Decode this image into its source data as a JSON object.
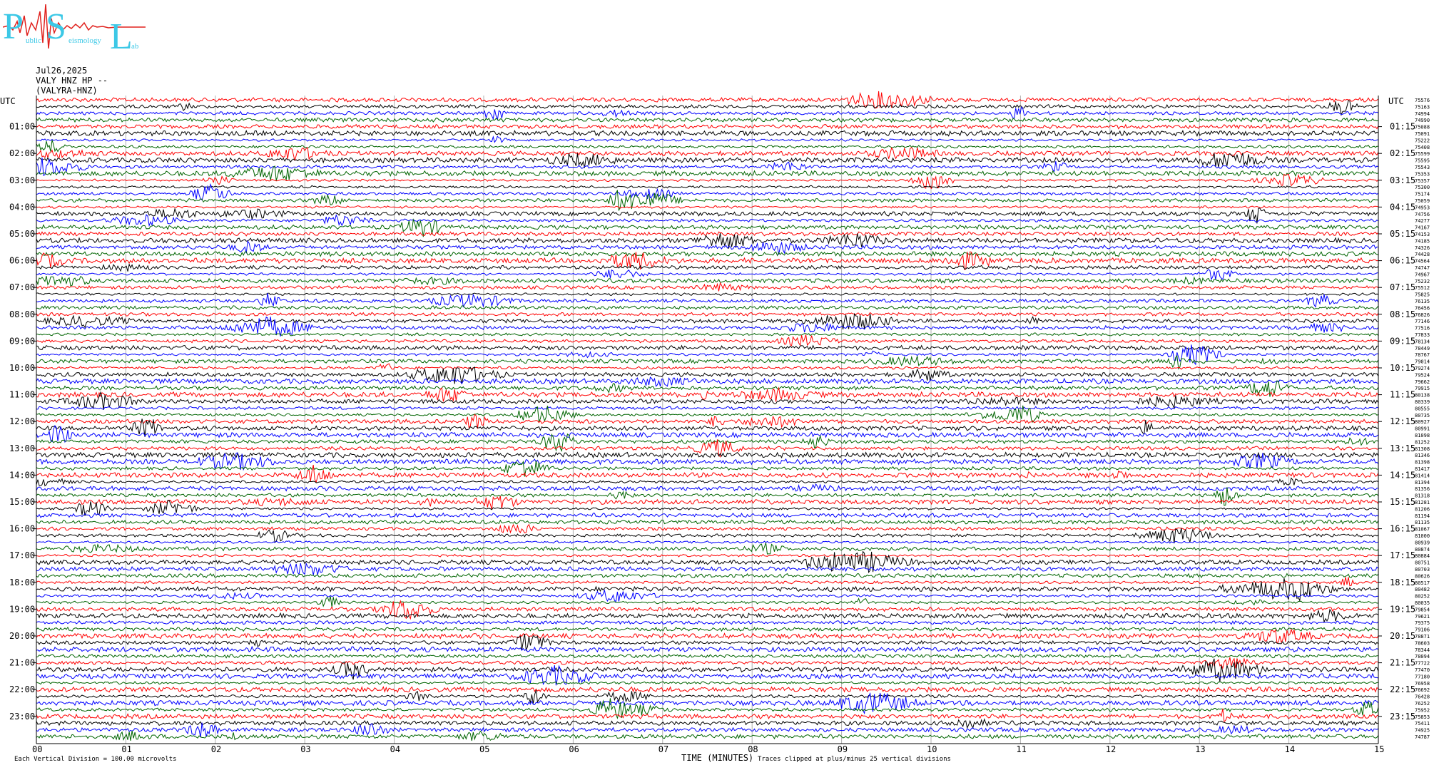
{
  "logo": {
    "big_letters": [
      "P",
      "S",
      "L"
    ],
    "small_text": [
      "ublic",
      "eismology",
      "ab"
    ],
    "colors": {
      "letters": "#3cc8e6",
      "trace": "#e0201c"
    }
  },
  "header": {
    "date": "Jul26,2025",
    "station_line": "VALY HNZ HP --",
    "station_name": "(VALYRA-HNZ)"
  },
  "footer": {
    "scale_note": "Each Vertical Division =  100.00 microvolts",
    "xlabel": "TIME (MINUTES)",
    "clip_note": "Traces clipped at plus/minus 25 vertical divisions"
  },
  "chart_data": {
    "type": "line",
    "title": "",
    "xlabel": "TIME (MINUTES)",
    "xlim": [
      0,
      15
    ],
    "x_ticks": [
      "00",
      "01",
      "02",
      "03",
      "04",
      "05",
      "06",
      "07",
      "08",
      "09",
      "10",
      "11",
      "12",
      "13",
      "14",
      "15"
    ],
    "left_axis_label": "UTC",
    "right_axis_label": "UTC",
    "left_time_labels": [
      "01:00",
      "02:00",
      "03:00",
      "04:00",
      "05:00",
      "06:00",
      "07:00",
      "08:00",
      "09:00",
      "10:00",
      "11:00",
      "12:00",
      "13:00",
      "14:00",
      "15:00",
      "16:00",
      "17:00",
      "18:00",
      "19:00",
      "20:00",
      "21:00",
      "22:00",
      "23:00"
    ],
    "right_time_labels": [
      "01:15",
      "02:15",
      "03:15",
      "04:15",
      "05:15",
      "06:15",
      "07:15",
      "08:15",
      "09:15",
      "10:15",
      "11:15",
      "12:15",
      "13:15",
      "14:15",
      "15:15",
      "16:15",
      "17:15",
      "18:15",
      "19:15",
      "20:15",
      "21:15",
      "22:15",
      "23:15"
    ],
    "trace_colors": [
      "#ff0000",
      "#000000",
      "#0000ff",
      "#006400"
    ],
    "trace_minutes": 15,
    "traces_per_hour": 4,
    "trace_offsets": [
      "75576",
      "75163",
      "74994",
      "74990",
      "75088",
      "75091",
      "75222",
      "75408",
      "75599",
      "75595",
      "75543",
      "75353",
      "75357",
      "75300",
      "75174",
      "75059",
      "74953",
      "74756",
      "74277",
      "74167",
      "74153",
      "74185",
      "74326",
      "74428",
      "74564",
      "74747",
      "74967",
      "75232",
      "75512",
      "75825",
      "76135",
      "76456",
      "76826",
      "77146",
      "77516",
      "77833",
      "78134",
      "78449",
      "78767",
      "79014",
      "79274",
      "79524",
      "79662",
      "79915",
      "80138",
      "80339",
      "80555",
      "80735",
      "80927",
      "80991",
      "81098",
      "81252",
      "81308",
      "81346",
      "81398",
      "81417",
      "81414",
      "81394",
      "81356",
      "81318",
      "81281",
      "81206",
      "81194",
      "81135",
      "81067",
      "81000",
      "80939",
      "80874",
      "80884",
      "80751",
      "80703",
      "80626",
      "80517",
      "80482",
      "80252",
      "80035",
      "79854",
      "79621",
      "79375",
      "79106",
      "78871",
      "78603",
      "78344",
      "78094",
      "77722",
      "77470",
      "77180",
      "76958",
      "76692",
      "76428",
      "76252",
      "75952",
      "75853",
      "75411",
      "74925",
      "74787"
    ]
  }
}
